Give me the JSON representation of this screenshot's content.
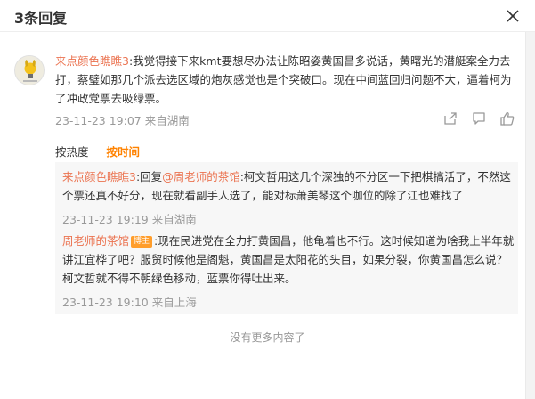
{
  "dialog": {
    "title": "3条回复",
    "close_icon": "close-icon"
  },
  "comment": {
    "username": "来点颜色瞧瞧3",
    "text": ":我觉得接下来kmt要想尽办法让陈昭姿黄国昌多说话，黄曙光的潜艇案全力去打，蔡璧如那几个派去选区域的炮灰感觉也是个突破口。现在中间蓝回归问题不大，逼着柯为了冲政党票去吸绿票。",
    "date": "23-11-23 19:07",
    "source": "来自湖南",
    "actions": {
      "share_icon": "share-icon",
      "comment_icon": "comment-icon",
      "like_icon": "thumbs-up-icon"
    }
  },
  "sort": {
    "by_heat": "按热度",
    "by_time": "按时间"
  },
  "replies": [
    {
      "username": "来点颜色瞧瞧3",
      "prefix": ":回复",
      "mention": "@周老师的茶馆",
      "text": ":柯文哲用这几个深独的不分区一下把棋搞活了，不然这个票还真不好分，现在就看副手人选了，能对标萧美琴这个咖位的除了江也难找了",
      "date": "23-11-23 19:19",
      "source": "来自湖南"
    },
    {
      "username": "周老师的茶馆",
      "badge": "博主",
      "text": ":现在民进党在全力打黄国昌，他龟着也不行。这时候知道为啥我上半年就讲江宜桦了吧？服贸时候他是阁魁，黄国昌是太阳花的头目，如果分裂，你黄国昌怎么说？柯文哲就不得不朝绿色移动，蓝票你得吐出来。",
      "date": "23-11-23 19:10",
      "source": "来自上海"
    }
  ],
  "footer": {
    "no_more": "没有更多内容了"
  },
  "colors": {
    "username": "#eb7350",
    "active_sort": "#ff8200",
    "badge": "#ff9d2b",
    "muted": "#999999"
  }
}
